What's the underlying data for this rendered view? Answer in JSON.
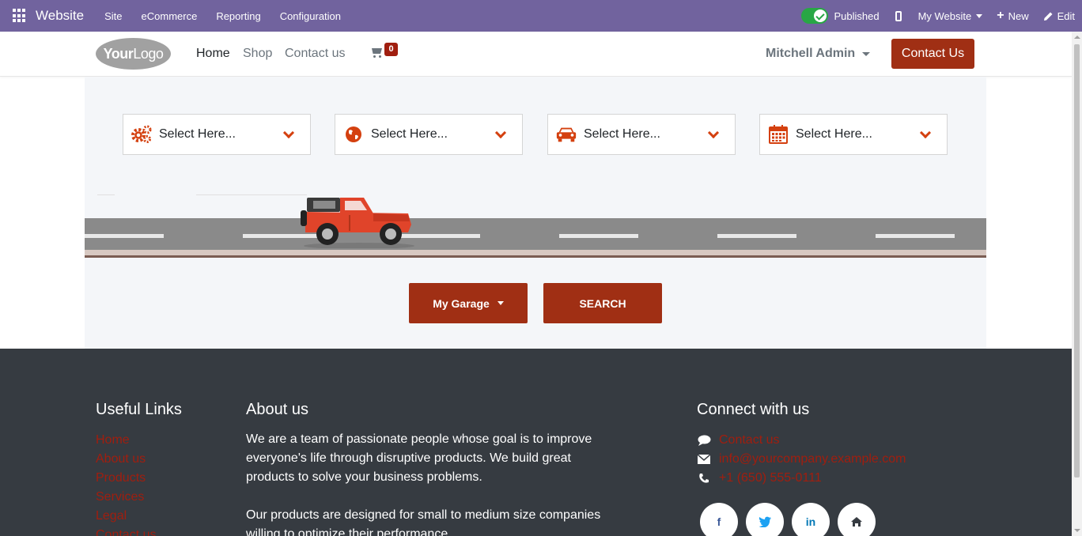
{
  "admin_bar": {
    "app_name": "Website",
    "menus": [
      "Site",
      "eCommerce",
      "Reporting",
      "Configuration"
    ],
    "published_label": "Published",
    "website_selector": "My Website",
    "new_label": "New",
    "edit_label": "Edit"
  },
  "header": {
    "logo_bold": "Your",
    "logo_light": "Logo",
    "nav": [
      "Home",
      "Shop",
      "Contact us"
    ],
    "cart_count": "0",
    "user_name": "Mitchell Admin",
    "contact_button": "Contact Us"
  },
  "search": {
    "selectors": [
      {
        "icon": "gears-icon",
        "placeholder": "Select Here..."
      },
      {
        "icon": "globe-icon",
        "placeholder": "Select Here..."
      },
      {
        "icon": "car-icon",
        "placeholder": "Select Here..."
      },
      {
        "icon": "calendar-icon",
        "placeholder": "Select Here..."
      }
    ],
    "garage_button": "My Garage",
    "search_button": "SEARCH"
  },
  "footer": {
    "useful_links_title": "Useful Links",
    "useful_links": [
      "Home",
      "About us",
      "Products",
      "Services",
      "Legal",
      "Contact us"
    ],
    "about_title": "About us",
    "about_p1": "We are a team of passionate people whose goal is to improve everyone's life through disruptive products. We build great products to solve your business problems.",
    "about_p2": "Our products are designed for small to medium size companies willing to optimize their performance.",
    "connect_title": "Connect with us",
    "contact_link": "Contact us",
    "email": "info@yourcompany.example.com",
    "phone": "+1 (650) 555-0111",
    "social": [
      "f",
      "✓",
      "in",
      "⌂"
    ]
  },
  "colors": {
    "admin_bar": "#71639e",
    "primary": "#a02f14",
    "icon_accent": "#d4400f",
    "footer_bg": "#363b41",
    "link": "#a01e0f"
  }
}
